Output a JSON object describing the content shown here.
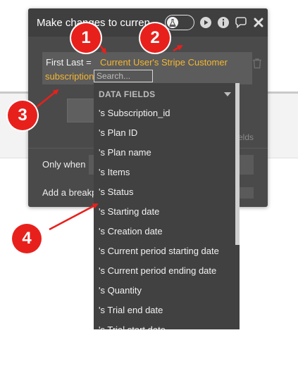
{
  "panel": {
    "title": "Make changes to curren",
    "field_label": "First Last  =",
    "expression_line1": "Current User's Stripe Customer",
    "expression_line2": "subscription",
    "search_placeholder": "Search...",
    "fields_hint": "elds",
    "only_when_label": "Only when",
    "breakpoint_label": "Add a breakp"
  },
  "dropdown": {
    "header": "DATA FIELDS",
    "items": [
      "'s Subscription_id",
      "'s Plan ID",
      "'s Plan name",
      "'s Items",
      "'s Status",
      "'s Starting date",
      "'s Creation date",
      "'s Current period starting date",
      "'s Current period ending date",
      "'s Quantity",
      "'s Trial end date",
      "'s Trial start date"
    ]
  },
  "annotations": [
    "1",
    "2",
    "3",
    "4"
  ],
  "colors": {
    "panel_bg": "#4a4a4a",
    "dropdown_bg": "#414141",
    "expression": "#f5b731",
    "annotation": "#e8201c"
  },
  "icons": [
    "flask-icon",
    "play-icon",
    "info-icon",
    "comment-icon",
    "close-icon",
    "trash-icon",
    "caret-down-icon"
  ]
}
